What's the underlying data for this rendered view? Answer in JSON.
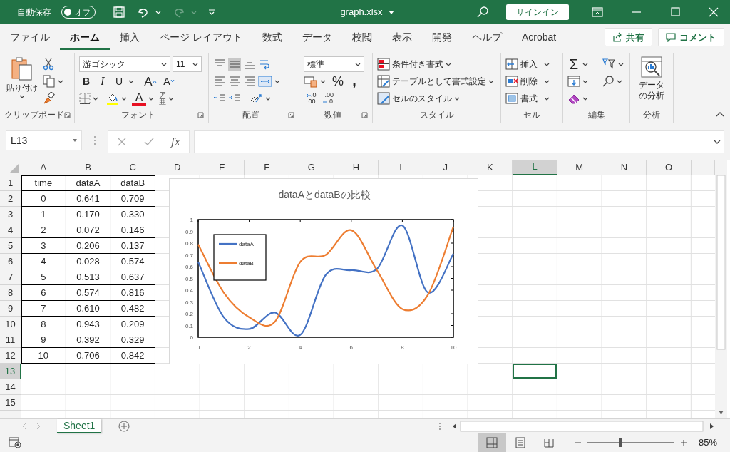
{
  "title_bar": {
    "autosave_label": "自動保存",
    "autosave": {
      "label": "オフ",
      "on": false
    },
    "redo_disabled": true,
    "filename": "graph.xlsx",
    "signin": "サインイン"
  },
  "tabs": [
    {
      "label": "ファイル",
      "selected": false
    },
    {
      "label": "ホーム",
      "selected": true
    },
    {
      "label": "挿入",
      "selected": false
    },
    {
      "label": "ページ レイアウト",
      "selected": false
    },
    {
      "label": "数式",
      "selected": false
    },
    {
      "label": "データ",
      "selected": false
    },
    {
      "label": "校閲",
      "selected": false
    },
    {
      "label": "表示",
      "selected": false
    },
    {
      "label": "開発",
      "selected": false
    },
    {
      "label": "ヘルプ",
      "selected": false
    },
    {
      "label": "Acrobat",
      "selected": false
    }
  ],
  "share": "共有",
  "comment": "コメント",
  "ribbon": {
    "clipboard": {
      "paste": "貼り付け",
      "label": "クリップボード"
    },
    "font": {
      "name": "游ゴシック",
      "size": "11",
      "styles": [
        "B",
        "I",
        "U"
      ],
      "grow": "A",
      "shrink": "A",
      "font_color_label": "A",
      "phonetic": [
        "ア",
        "亜"
      ],
      "label": "フォント"
    },
    "alignment": {
      "vertical": [
        {
          "kind": "top",
          "selected": false
        },
        {
          "kind": "middle",
          "selected": true
        },
        {
          "kind": "bottom",
          "selected": false
        }
      ],
      "label": "配置"
    },
    "number": {
      "format": "標準",
      "percent": "%",
      "comma": ",",
      "increase_decimal": [
        ".0",
        ".00"
      ],
      "decrease_decimal": [
        ".00",
        ".0"
      ],
      "label": "数値"
    },
    "styles": {
      "items": [
        {
          "kind": "conditional",
          "label": "条件付き書式"
        },
        {
          "kind": "table",
          "label": "テーブルとして書式設定"
        },
        {
          "kind": "cell",
          "label": "セルのスタイル"
        }
      ],
      "label": "スタイル"
    },
    "cells": {
      "items": [
        {
          "kind": "insert",
          "label": "挿入"
        },
        {
          "kind": "delete",
          "label": "削除"
        },
        {
          "kind": "format",
          "label": "書式"
        }
      ],
      "label": "セル"
    },
    "editing": {
      "sum": "Σ",
      "label": "編集"
    },
    "analysis": {
      "button": [
        "データ",
        "の分析"
      ],
      "label": "分析"
    }
  },
  "formula_bar": {
    "name_box": "L13",
    "function": "fx"
  },
  "sheet": {
    "columns": [
      {
        "label": "A",
        "selected": false
      },
      {
        "label": "B",
        "selected": false
      },
      {
        "label": "C",
        "selected": false
      },
      {
        "label": "D",
        "selected": false
      },
      {
        "label": "E",
        "selected": false
      },
      {
        "label": "F",
        "selected": false
      },
      {
        "label": "G",
        "selected": false
      },
      {
        "label": "H",
        "selected": false
      },
      {
        "label": "I",
        "selected": false
      },
      {
        "label": "J",
        "selected": false
      },
      {
        "label": "K",
        "selected": false
      },
      {
        "label": "L",
        "selected": true
      },
      {
        "label": "M",
        "selected": false
      },
      {
        "label": "N",
        "selected": false
      },
      {
        "label": "O",
        "selected": false
      }
    ],
    "rows": [
      {
        "label": "1",
        "selected": false,
        "cells": [
          "time",
          "dataA",
          "dataB"
        ]
      },
      {
        "label": "2",
        "selected": false,
        "cells": [
          "0",
          "0.641",
          "0.709"
        ]
      },
      {
        "label": "3",
        "selected": false,
        "cells": [
          "1",
          "0.170",
          "0.330"
        ]
      },
      {
        "label": "4",
        "selected": false,
        "cells": [
          "2",
          "0.072",
          "0.146"
        ]
      },
      {
        "label": "5",
        "selected": false,
        "cells": [
          "3",
          "0.206",
          "0.137"
        ]
      },
      {
        "label": "6",
        "selected": false,
        "cells": [
          "4",
          "0.028",
          "0.574"
        ]
      },
      {
        "label": "7",
        "selected": false,
        "cells": [
          "5",
          "0.513",
          "0.637"
        ]
      },
      {
        "label": "8",
        "selected": false,
        "cells": [
          "6",
          "0.574",
          "0.816"
        ]
      },
      {
        "label": "9",
        "selected": false,
        "cells": [
          "7",
          "0.610",
          "0.482"
        ]
      },
      {
        "label": "10",
        "selected": false,
        "cells": [
          "8",
          "0.943",
          "0.209"
        ]
      },
      {
        "label": "11",
        "selected": false,
        "cells": [
          "9",
          "0.392",
          "0.329"
        ]
      },
      {
        "label": "12",
        "selected": false,
        "cells": [
          "10",
          "0.706",
          "0.842"
        ]
      },
      {
        "label": "13",
        "selected": true
      },
      {
        "label": "14",
        "selected": false
      },
      {
        "label": "15",
        "selected": false
      }
    ]
  },
  "chart": {
    "chart_data": {
      "type": "line",
      "title": "dataAとdataBの比較",
      "x": [
        0,
        1,
        2,
        3,
        4,
        5,
        6,
        7,
        8,
        9,
        10
      ],
      "series": [
        {
          "name": "dataA",
          "color": "#4472c4",
          "values": [
            0.64,
            0.17,
            0.07,
            0.21,
            0.02,
            0.53,
            0.57,
            0.58,
            0.95,
            0.38,
            0.71
          ]
        },
        {
          "name": "dataB",
          "color": "#ed7d31",
          "values": [
            0.79,
            0.38,
            0.17,
            0.13,
            0.64,
            0.7,
            0.91,
            0.57,
            0.24,
            0.36,
            0.94
          ]
        }
      ],
      "legend": true,
      "xlim": [
        0,
        10
      ],
      "ylim": [
        0,
        1
      ],
      "xticks": [
        {
          "value": 0,
          "label": "0"
        },
        {
          "value": 2,
          "label": "2"
        },
        {
          "value": 4,
          "label": "4"
        },
        {
          "value": 6,
          "label": "6"
        },
        {
          "value": 8,
          "label": "8"
        },
        {
          "value": 10,
          "label": "10"
        }
      ],
      "yticks": [
        {
          "value": 0,
          "label": "0"
        },
        {
          "value": 0.1,
          "label": "0.1"
        },
        {
          "value": 0.2,
          "label": "0.2"
        },
        {
          "value": 0.3,
          "label": "0.3"
        },
        {
          "value": 0.4,
          "label": "0.4"
        },
        {
          "value": 0.5,
          "label": "0.5"
        },
        {
          "value": 0.6,
          "label": "0.6"
        },
        {
          "value": 0.7,
          "label": "0.7"
        },
        {
          "value": 0.8,
          "label": "0.8"
        },
        {
          "value": 0.9,
          "label": "0.9"
        },
        {
          "value": 1,
          "label": "1"
        }
      ]
    }
  },
  "sheet_tabs": [
    {
      "label": "Sheet1",
      "selected": true
    }
  ],
  "status_bar": {
    "views": [
      {
        "kind": "normal",
        "selected": true
      },
      {
        "kind": "page_layout",
        "selected": false
      },
      {
        "kind": "page_break",
        "selected": false
      }
    ],
    "zoom": {
      "level": 0.38,
      "reading": "85%"
    }
  }
}
